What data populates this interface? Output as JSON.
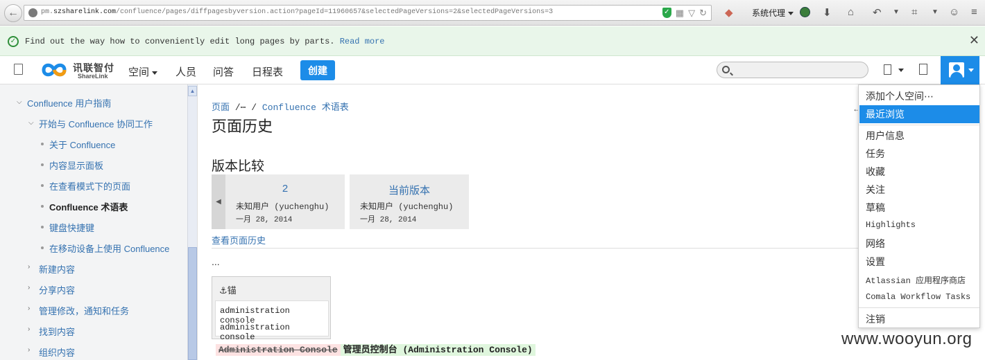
{
  "browser": {
    "url_prefix": "pm.",
    "url_domain": "szsharelink.com",
    "url_path": "/confluence/pages/diffpagesbyversion.action?pageId=11960657&selectedPageVersions=2&selectedPageVersions=3",
    "proxy_label": "系统代理"
  },
  "notice": {
    "text": "Find out the way how to conveniently edit long pages by parts.",
    "link": "Read more",
    "close": "✕"
  },
  "header": {
    "logo_cn": "讯联智付",
    "logo_en": "ShareLink",
    "nav": [
      "空间",
      "人员",
      "问答",
      "日程表"
    ],
    "create": "创建"
  },
  "sidebar": {
    "root": "Confluence 用户指南",
    "group": "开始与 Confluence 协同工作",
    "children": [
      "关于 Confluence",
      "内容显示面板",
      "在查看模式下的页面",
      "Confluence 术语表",
      "键盘快捷键",
      "在移动设备上使用 Confluence"
    ],
    "sections": [
      "新建内容",
      "分享内容",
      "管理修改，通知和任务",
      "找到内容",
      "组织内容"
    ]
  },
  "main": {
    "breadcrumb": [
      "页面",
      "/⋯",
      "/",
      "Confluence 术语表"
    ],
    "title": "页面历史",
    "subtitle": "版本比较",
    "versions": [
      {
        "label": "2",
        "user": "未知用户 (yuchenghu)",
        "date": "一月 28, 2014"
      },
      {
        "label": "当前版本",
        "user": "未知用户 (yuchenghu)",
        "date": "一月 28, 2014"
      }
    ],
    "history_link": "查看页面历史",
    "ellipsis": "...",
    "anchor_title": "锚",
    "anchor_lines": [
      "administration console",
      "administration console"
    ],
    "diff_deleted": "Administration Console",
    "diff_added": "管理员控制台 (Administration Console)"
  },
  "user_menu": {
    "items": [
      "添加个人空间⋯",
      "最近浏览",
      "用户信息",
      "任务",
      "收藏",
      "关注",
      "草稿",
      "Highlights",
      "网络",
      "设置",
      "Atlassian 应用程序商店",
      "Comala Workflow Tasks",
      "注销"
    ]
  },
  "watermark": "www.wooyun.org"
}
